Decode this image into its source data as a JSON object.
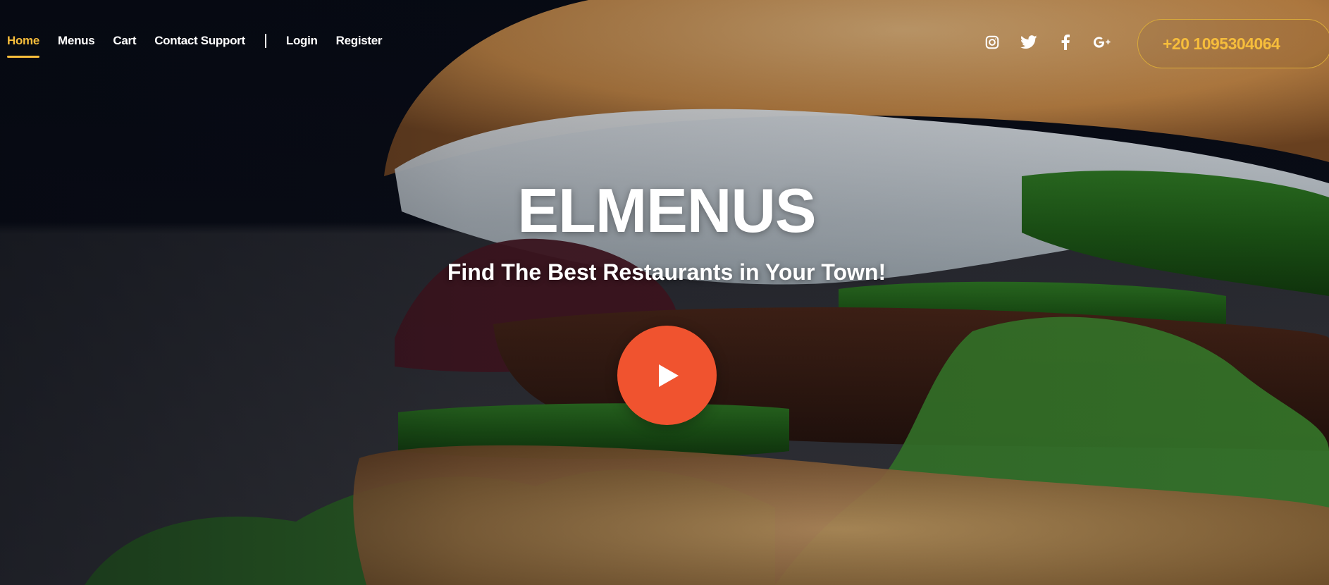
{
  "nav": {
    "items": [
      {
        "label": "Home",
        "active": true
      },
      {
        "label": "Menus",
        "active": false
      },
      {
        "label": "Cart",
        "active": false
      },
      {
        "label": "Contact Support",
        "active": false
      }
    ],
    "auth": [
      {
        "label": "Login"
      },
      {
        "label": "Register"
      }
    ]
  },
  "social": [
    "instagram-icon",
    "twitter-icon",
    "facebook-icon",
    "google-plus-icon"
  ],
  "phone": "+20 1095304064",
  "hero": {
    "title": "ELMENUS",
    "subtitle": "Find The Best Restaurants in Your Town!",
    "play_icon": "play-icon"
  },
  "colors": {
    "accent": "#f6bd3b",
    "play": "#f0532f",
    "text": "#ffffff"
  }
}
